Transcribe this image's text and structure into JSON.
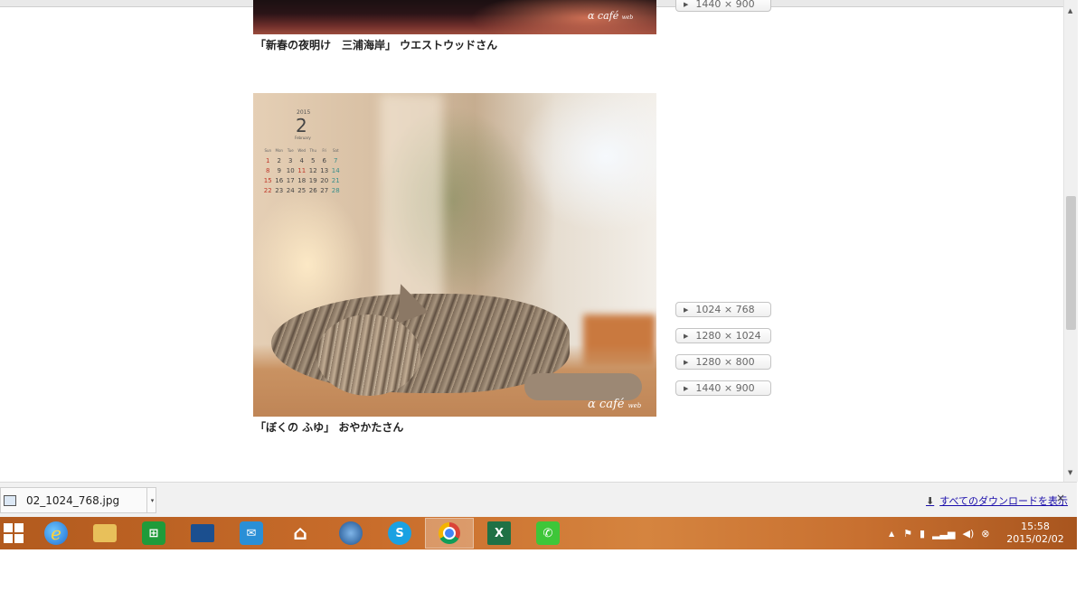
{
  "gallery": {
    "items": [
      {
        "caption": "「新春の夜明け　三浦海岸」 ウエストウッドさん",
        "logo_text": "α café",
        "logo_sub": "web",
        "resolutions": [
          "1440 × 900"
        ]
      },
      {
        "caption": "「ぼくの ふゆ」 おやかたさん",
        "logo_text": "α café",
        "logo_sub": "web",
        "resolutions": [
          "1024 × 768",
          "1280 × 1024",
          "1280 × 800",
          "1440 × 900"
        ],
        "calendar": {
          "year": "2015",
          "month": "2",
          "month_name": "February",
          "weekdays": [
            "Sun",
            "Mon",
            "Tue",
            "Wed",
            "Thu",
            "Fri",
            "Sat"
          ],
          "weeks": [
            [
              "1",
              "2",
              "3",
              "4",
              "5",
              "6",
              "7"
            ],
            [
              "8",
              "9",
              "10",
              "11",
              "12",
              "13",
              "14"
            ],
            [
              "15",
              "16",
              "17",
              "18",
              "19",
              "20",
              "21"
            ],
            [
              "22",
              "23",
              "24",
              "25",
              "26",
              "27",
              "28"
            ]
          ]
        }
      }
    ]
  },
  "download_bar": {
    "file_name": "02_1024_768.jpg",
    "show_all_label": "すべてのダウンロードを表示",
    "close_label": "×"
  },
  "taskbar": {
    "apps": [
      {
        "name": "start",
        "icon": "windows-logo-icon"
      },
      {
        "name": "internet-explorer",
        "icon": "ie-icon"
      },
      {
        "name": "file-explorer",
        "icon": "folder-icon"
      },
      {
        "name": "store",
        "icon": "store-icon"
      },
      {
        "name": "lenovo",
        "icon": "monitor-icon"
      },
      {
        "name": "mail",
        "icon": "mail-icon"
      },
      {
        "name": "home",
        "icon": "home-icon"
      },
      {
        "name": "thunderbird",
        "icon": "thunderbird-icon"
      },
      {
        "name": "skype",
        "icon": "skype-icon"
      },
      {
        "name": "chrome",
        "icon": "chrome-icon",
        "active": true
      },
      {
        "name": "excel",
        "icon": "excel-icon"
      },
      {
        "name": "line",
        "icon": "line-icon"
      }
    ],
    "clock": {
      "time": "15:58",
      "date": "2015/02/02"
    }
  },
  "colors": {
    "taskbar": "#c96d2b",
    "link": "#1a0dab",
    "sunday": "#c0392b",
    "saturday": "#3a8e8a"
  }
}
